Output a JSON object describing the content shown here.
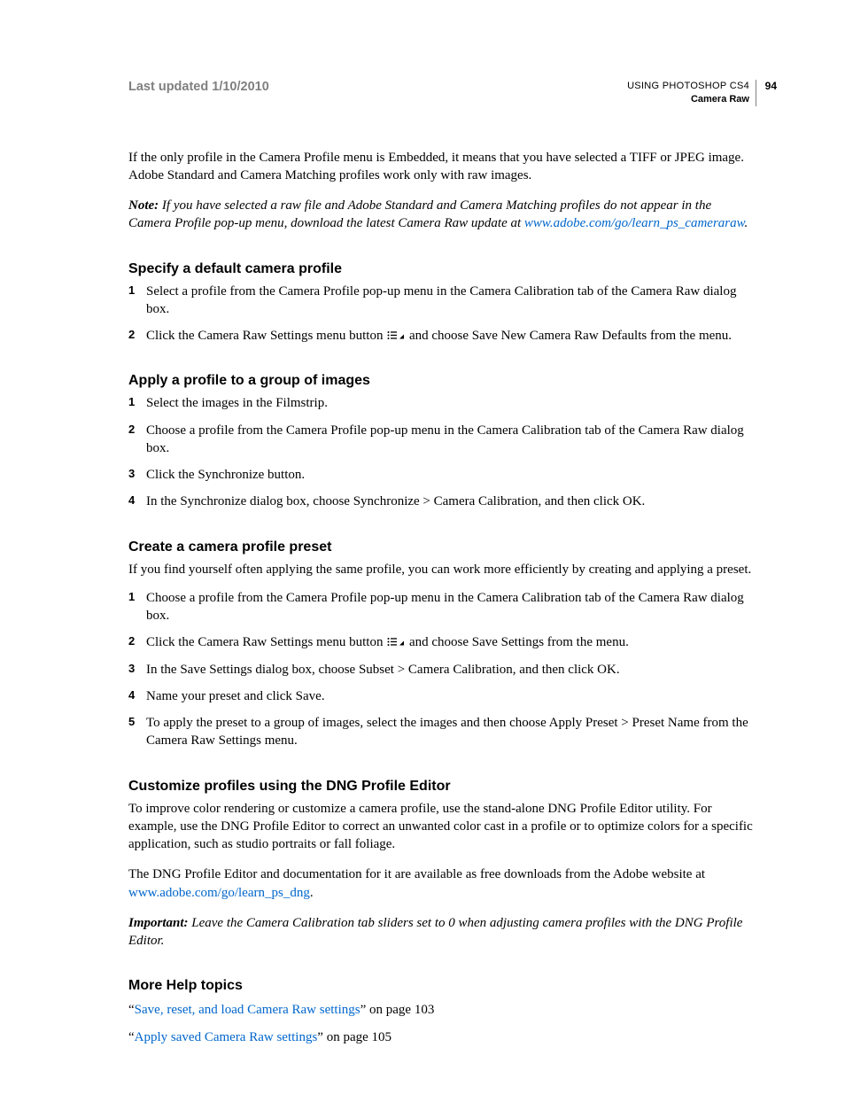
{
  "header": {
    "last_updated": "Last updated 1/10/2010",
    "doc_title": "USING PHOTOSHOP CS4",
    "section_title": "Camera Raw",
    "page_number": "94"
  },
  "intro": {
    "p1": "If the only profile in the Camera Profile menu is Embedded, it means that you have selected a TIFF or JPEG image. Adobe Standard and Camera Matching profiles work only with raw images.",
    "note_label": "Note:",
    "note_body_1": " If you have selected a raw file and Adobe Standard and Camera Matching profiles do not appear in the Camera Profile pop-up menu, download the latest Camera Raw update at ",
    "note_link": "www.adobe.com/go/learn_ps_cameraraw",
    "note_body_2": "."
  },
  "sec1": {
    "heading": "Specify a default camera profile",
    "step1": "Select a profile from the Camera Profile pop-up menu in the Camera Calibration tab of the Camera Raw dialog box.",
    "step2a": "Click the Camera Raw Settings menu button ",
    "step2b": " and choose Save New Camera Raw Defaults from the menu."
  },
  "sec2": {
    "heading": "Apply a profile to a group of images",
    "step1": "Select the images in the Filmstrip.",
    "step2": "Choose a profile from the Camera Profile pop-up menu in the Camera Calibration tab of the Camera Raw dialog box.",
    "step3": "Click the Synchronize button.",
    "step4": "In the Synchronize dialog box, choose Synchronize > Camera Calibration, and then click OK."
  },
  "sec3": {
    "heading": "Create a camera profile preset",
    "intro": "If you find yourself often applying the same profile, you can work more efficiently by creating and applying a preset.",
    "step1": "Choose a profile from the Camera Profile pop-up menu in the Camera Calibration tab of the Camera Raw dialog box.",
    "step2a": "Click the Camera Raw Settings menu button ",
    "step2b": " and choose Save Settings from the menu.",
    "step3": "In the Save Settings dialog box, choose Subset > Camera Calibration, and then click OK.",
    "step4": "Name your preset and click Save.",
    "step5": "To apply the preset to a group of images, select the images and then choose Apply Preset > Preset Name from the Camera Raw Settings menu."
  },
  "sec4": {
    "heading": "Customize profiles using the DNG Profile Editor",
    "p1": "To improve color rendering or customize a camera profile, use the stand-alone DNG Profile Editor utility. For example, use the DNG Profile Editor to correct an unwanted color cast in a profile or to optimize colors for a specific application, such as studio portraits or fall foliage.",
    "p2a": "The DNG Profile Editor and documentation for it are available as free downloads from the Adobe website at ",
    "p2_link": "www.adobe.com/go/learn_ps_dng",
    "p2b": ".",
    "important_label": "Important:",
    "important_body": " Leave the Camera Calibration tab sliders set to 0 when adjusting camera profiles with the DNG Profile Editor."
  },
  "more": {
    "heading": "More Help topics",
    "t1_pre": "“",
    "t1_link": "Save, reset, and load Camera Raw settings",
    "t1_post": "” on page 103",
    "t2_pre": "“",
    "t2_link": "Apply saved Camera Raw settings",
    "t2_post": "” on page 105"
  }
}
